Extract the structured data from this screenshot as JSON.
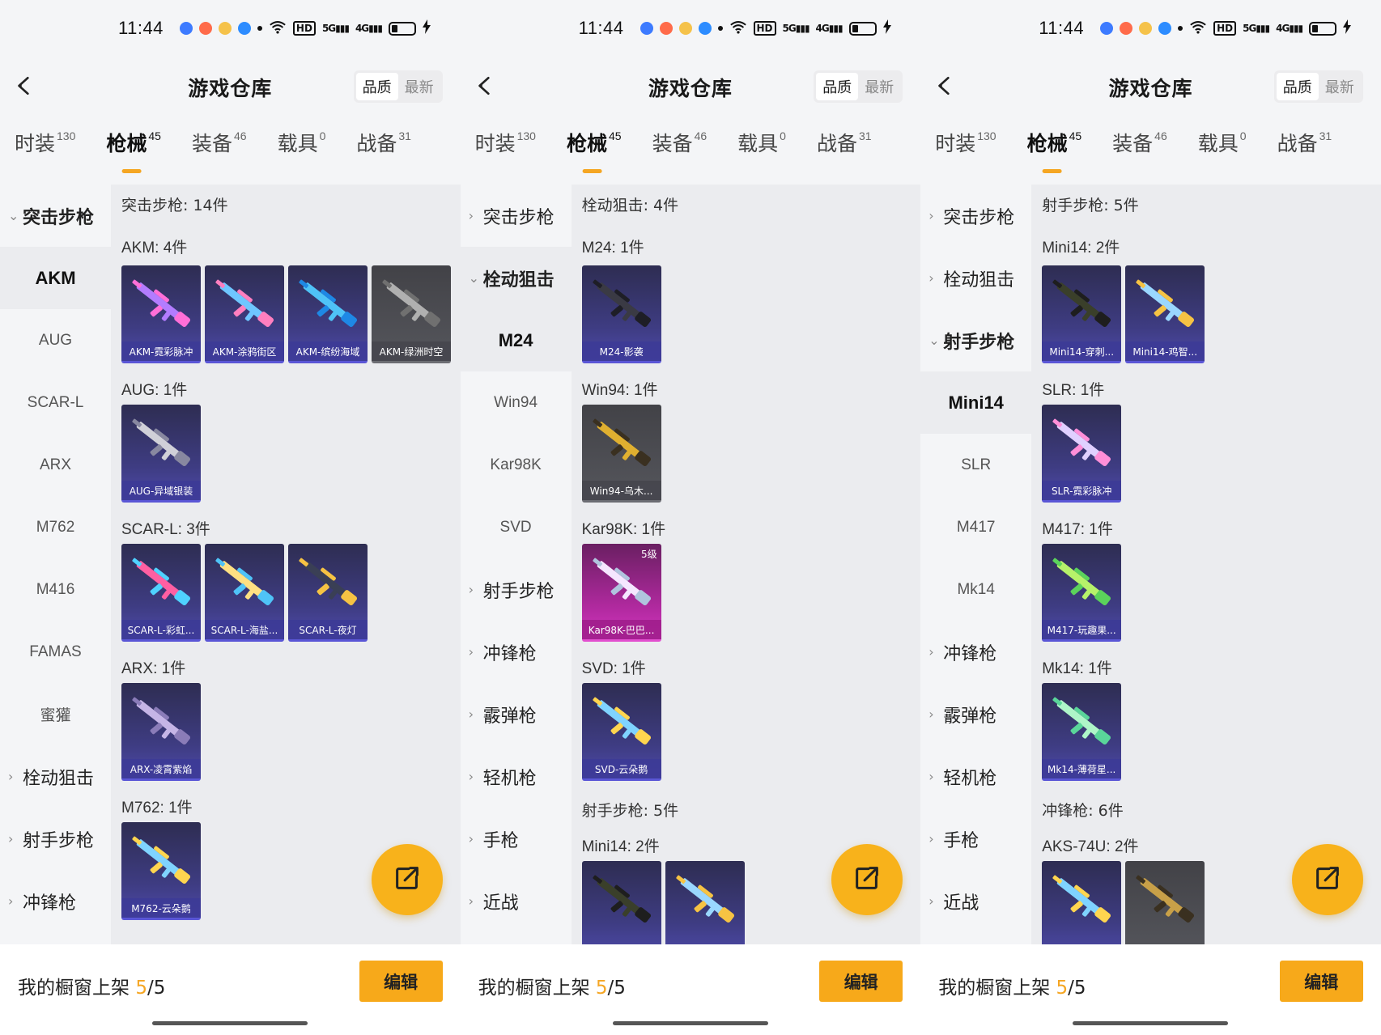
{
  "common": {
    "time": "11:44",
    "title": "游戏仓库",
    "sort_options": [
      "品质",
      "最新"
    ],
    "active_sort": 0,
    "tabs": [
      {
        "label": "时装",
        "count": "130"
      },
      {
        "label": "枪械",
        "count": "45"
      },
      {
        "label": "装备",
        "count": "46"
      },
      {
        "label": "载具",
        "count": "0"
      },
      {
        "label": "战备",
        "count": "31"
      }
    ],
    "active_tab": 1,
    "footer_label": "我的橱窗上架",
    "footer_current": "5",
    "footer_total": "/5",
    "edit_label": "编辑"
  },
  "panels": [
    {
      "sidebar": [
        {
          "type": "cat",
          "label": "突击步枪",
          "open": true
        },
        {
          "type": "item",
          "label": "AKM",
          "active": true
        },
        {
          "type": "item",
          "label": "AUG"
        },
        {
          "type": "item",
          "label": "SCAR-L"
        },
        {
          "type": "item",
          "label": "ARX"
        },
        {
          "type": "item",
          "label": "M762"
        },
        {
          "type": "item",
          "label": "M416"
        },
        {
          "type": "item",
          "label": "FAMAS"
        },
        {
          "type": "item",
          "label": "蜜獾"
        },
        {
          "type": "cat",
          "label": "栓动狙击"
        },
        {
          "type": "cat",
          "label": "射手步枪"
        },
        {
          "type": "cat",
          "label": "冲锋枪"
        }
      ],
      "content": [
        {
          "kind": "sec",
          "text": "突击步枪: 14件"
        },
        {
          "kind": "grp",
          "text": "AKM: 4件",
          "first": true
        },
        {
          "kind": "cards",
          "items": [
            {
              "label": "AKM-霓彩脉冲",
              "c1": "#b37cff",
              "c2": "#ff6fd8"
            },
            {
              "label": "AKM-涂鸦街区",
              "c1": "#6ec6ff",
              "c2": "#ff7fbf"
            },
            {
              "label": "AKM-缤纷海域",
              "c1": "#4fc3f7",
              "c2": "#1e88e5"
            },
            {
              "label": "AKM-绿洲时空",
              "c1": "#b0b0b0",
              "c2": "#707070",
              "style": "grey"
            }
          ]
        },
        {
          "kind": "grp",
          "text": "AUG: 1件"
        },
        {
          "kind": "cards",
          "items": [
            {
              "label": "AUG-异域银装",
              "c1": "#d0d0d8",
              "c2": "#8888a0"
            }
          ]
        },
        {
          "kind": "grp",
          "text": "SCAR-L: 3件"
        },
        {
          "kind": "cards",
          "items": [
            {
              "label": "SCAR-L-彩虹...",
              "c1": "#ff5fa2",
              "c2": "#4fd2ff"
            },
            {
              "label": "SCAR-L-海盐...",
              "c1": "#ffe082",
              "c2": "#4fc3f7"
            },
            {
              "label": "SCAR-L-夜灯",
              "c1": "#3a3f55",
              "c2": "#f6c343"
            }
          ]
        },
        {
          "kind": "grp",
          "text": "ARX: 1件"
        },
        {
          "kind": "cards",
          "items": [
            {
              "label": "ARX-凌霄紫焰",
              "c1": "#c5b5e6",
              "c2": "#8a7cb8"
            }
          ]
        },
        {
          "kind": "grp",
          "text": "M762: 1件"
        },
        {
          "kind": "cards",
          "items": [
            {
              "label": "M762-云朵鹅",
              "c1": "#7fd3ff",
              "c2": "#ffd54f"
            }
          ]
        }
      ]
    },
    {
      "sidebar": [
        {
          "type": "cat",
          "label": "突击步枪"
        },
        {
          "type": "cat",
          "label": "栓动狙击",
          "open": true,
          "sel": true
        },
        {
          "type": "item",
          "label": "M24",
          "active": true
        },
        {
          "type": "item",
          "label": "Win94"
        },
        {
          "type": "item",
          "label": "Kar98K"
        },
        {
          "type": "item",
          "label": "SVD"
        },
        {
          "type": "cat",
          "label": "射手步枪"
        },
        {
          "type": "cat",
          "label": "冲锋枪"
        },
        {
          "type": "cat",
          "label": "霰弹枪"
        },
        {
          "type": "cat",
          "label": "轻机枪"
        },
        {
          "type": "cat",
          "label": "手枪"
        },
        {
          "type": "cat",
          "label": "近战"
        }
      ],
      "content": [
        {
          "kind": "sec",
          "text": "栓动狙击: 4件"
        },
        {
          "kind": "grp",
          "text": "M24: 1件",
          "first": true
        },
        {
          "kind": "cards",
          "items": [
            {
              "label": "M24-影袭",
              "c1": "#3a3a44",
              "c2": "#1e1e26"
            }
          ]
        },
        {
          "kind": "grp",
          "text": "Win94: 1件"
        },
        {
          "kind": "cards",
          "items": [
            {
              "label": "Win94-乌木...",
              "c1": "#e0b030",
              "c2": "#3a3020",
              "style": "grey"
            }
          ]
        },
        {
          "kind": "grp",
          "text": "Kar98K: 1件"
        },
        {
          "kind": "cards",
          "items": [
            {
              "label": "Kar98K-巴巴...",
              "c1": "#f5e6ff",
              "c2": "#b0c4de",
              "style": "pink",
              "level": "5级"
            }
          ]
        },
        {
          "kind": "grp",
          "text": "SVD: 1件"
        },
        {
          "kind": "cards",
          "items": [
            {
              "label": "SVD-云朵鹅",
              "c1": "#7fd3ff",
              "c2": "#ffd54f"
            }
          ]
        },
        {
          "kind": "sec",
          "text": "射手步枪: 5件"
        },
        {
          "kind": "grp",
          "text": "Mini14: 2件"
        },
        {
          "kind": "cards",
          "items": [
            {
              "label": "",
              "c1": "#3a3f2a",
              "c2": "#1e1e1e"
            },
            {
              "label": "",
              "c1": "#9ad7ff",
              "c2": "#f6c343"
            }
          ]
        }
      ]
    },
    {
      "sidebar": [
        {
          "type": "cat",
          "label": "突击步枪"
        },
        {
          "type": "cat",
          "label": "栓动狙击"
        },
        {
          "type": "cat",
          "label": "射手步枪",
          "open": true
        },
        {
          "type": "item",
          "label": "Mini14",
          "active": true
        },
        {
          "type": "item",
          "label": "SLR"
        },
        {
          "type": "item",
          "label": "M417"
        },
        {
          "type": "item",
          "label": "Mk14"
        },
        {
          "type": "cat",
          "label": "冲锋枪"
        },
        {
          "type": "cat",
          "label": "霰弹枪"
        },
        {
          "type": "cat",
          "label": "轻机枪"
        },
        {
          "type": "cat",
          "label": "手枪"
        },
        {
          "type": "cat",
          "label": "近战"
        }
      ],
      "content": [
        {
          "kind": "sec",
          "text": "射手步枪: 5件"
        },
        {
          "kind": "grp",
          "text": "Mini14: 2件",
          "first": true
        },
        {
          "kind": "cards",
          "items": [
            {
              "label": "Mini14-穿刺...",
              "c1": "#3a3f2a",
              "c2": "#1e1e1e"
            },
            {
              "label": "Mini14-鸡智...",
              "c1": "#9ad7ff",
              "c2": "#f6c343"
            }
          ]
        },
        {
          "kind": "grp",
          "text": "SLR: 1件"
        },
        {
          "kind": "cards",
          "items": [
            {
              "label": "SLR-霓彩脉冲",
              "c1": "#e0d0ff",
              "c2": "#ff8fd8"
            }
          ]
        },
        {
          "kind": "grp",
          "text": "M417: 1件"
        },
        {
          "kind": "cards",
          "items": [
            {
              "label": "M417-玩趣果...",
              "c1": "#b6f26a",
              "c2": "#5bd35b"
            }
          ]
        },
        {
          "kind": "grp",
          "text": "Mk14: 1件"
        },
        {
          "kind": "cards",
          "items": [
            {
              "label": "Mk14-薄荷星...",
              "c1": "#aef5c8",
              "c2": "#5ad59a"
            }
          ]
        },
        {
          "kind": "sec",
          "text": "冲锋枪: 6件"
        },
        {
          "kind": "grp",
          "text": "AKS-74U: 2件"
        },
        {
          "kind": "cards",
          "items": [
            {
              "label": "",
              "c1": "#7fd3ff",
              "c2": "#ffd54f"
            },
            {
              "label": "",
              "c1": "#c8a048",
              "c2": "#3a3020",
              "style": "grey"
            }
          ]
        }
      ]
    }
  ]
}
